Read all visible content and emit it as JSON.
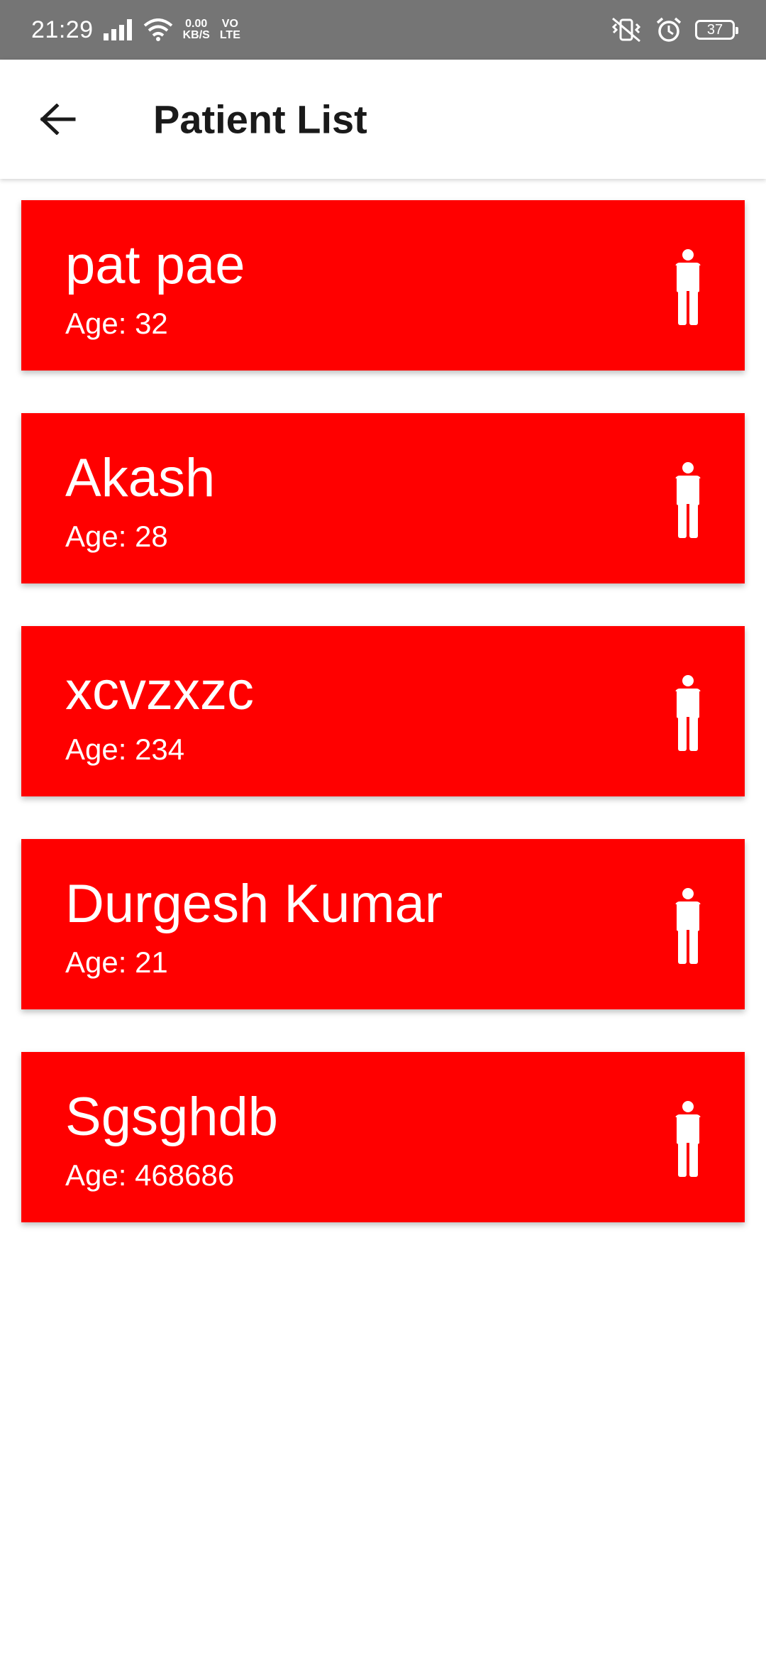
{
  "status_bar": {
    "time": "21:29",
    "net_speed_value": "0.00",
    "net_speed_unit": "KB/S",
    "volte_top": "VO",
    "volte_bottom": "LTE",
    "battery": "37",
    "icons": [
      "signal-icon",
      "wifi-icon",
      "vibrate-icon",
      "alarm-icon",
      "battery-icon"
    ]
  },
  "app_bar": {
    "title": "Patient List",
    "back_icon": "arrow-left-icon"
  },
  "patients": [
    {
      "name": "pat pae",
      "age": "Age: 32"
    },
    {
      "name": "Akash",
      "age": "Age: 28"
    },
    {
      "name": "xcvzxzc",
      "age": "Age: 234"
    },
    {
      "name": "Durgesh Kumar",
      "age": "Age: 21"
    },
    {
      "name": "Sgsghdb",
      "age": "Age: 468686"
    }
  ],
  "colors": {
    "status_bar": "#757575",
    "card": "#ff0000",
    "card_text": "#ffffff",
    "title_text": "#1a1a1a"
  },
  "card_icon": "person-icon"
}
